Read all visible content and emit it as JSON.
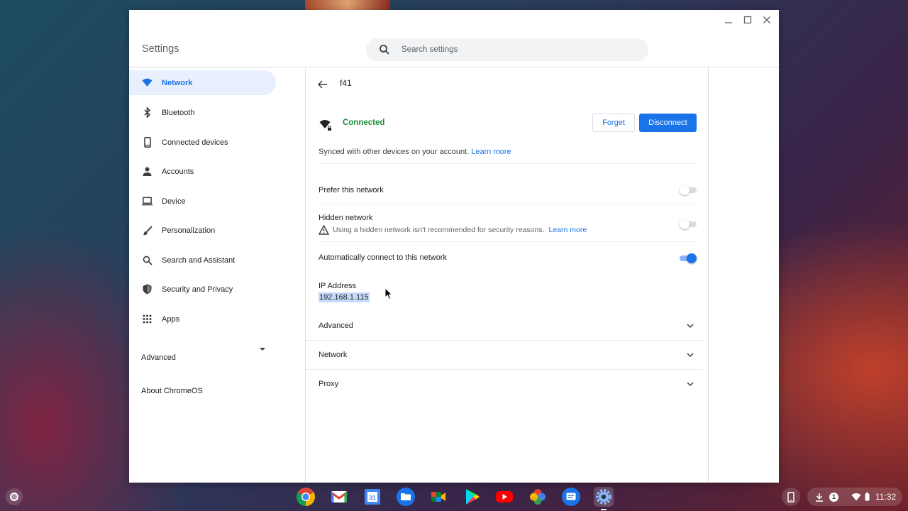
{
  "window": {
    "title": "Settings",
    "search_placeholder": "Search settings"
  },
  "sidebar": {
    "items": [
      {
        "label": "Network",
        "icon": "wifi-icon",
        "active": true
      },
      {
        "label": "Bluetooth",
        "icon": "bluetooth-icon"
      },
      {
        "label": "Connected devices",
        "icon": "phone-icon"
      },
      {
        "label": "Accounts",
        "icon": "person-icon"
      },
      {
        "label": "Device",
        "icon": "laptop-icon"
      },
      {
        "label": "Personalization",
        "icon": "brush-icon"
      },
      {
        "label": "Search and Assistant",
        "icon": "search-icon"
      },
      {
        "label": "Security and Privacy",
        "icon": "shield-icon"
      },
      {
        "label": "Apps",
        "icon": "apps-grid-icon"
      }
    ],
    "advanced": "Advanced",
    "about": "About ChromeOS"
  },
  "detail": {
    "network_name": "f41",
    "status": "Connected",
    "forget_label": "Forget",
    "disconnect_label": "Disconnect",
    "synced_text": "Synced with other devices on your account.",
    "learn_more": "Learn more",
    "prefer_network": {
      "label": "Prefer this network",
      "on": false
    },
    "hidden_network": {
      "label": "Hidden network",
      "on": false,
      "warning": "Using a hidden network isn't recommended for security reasons.",
      "learn_more": "Learn more"
    },
    "auto_connect": {
      "label": "Automatically connect to this network",
      "on": true
    },
    "ip_label": "IP Address",
    "ip_value": "192.168.1.115",
    "sections": [
      "Advanced",
      "Network",
      "Proxy"
    ]
  },
  "shelf": {
    "apps": [
      "Chrome",
      "Gmail",
      "Calendar",
      "Files",
      "Meet",
      "Play Store",
      "YouTube",
      "Photos",
      "Messages",
      "Settings"
    ],
    "notification_count": "1",
    "time": "11:32"
  },
  "colors": {
    "accent": "#1a73e8",
    "connected": "#1e8e3e"
  }
}
